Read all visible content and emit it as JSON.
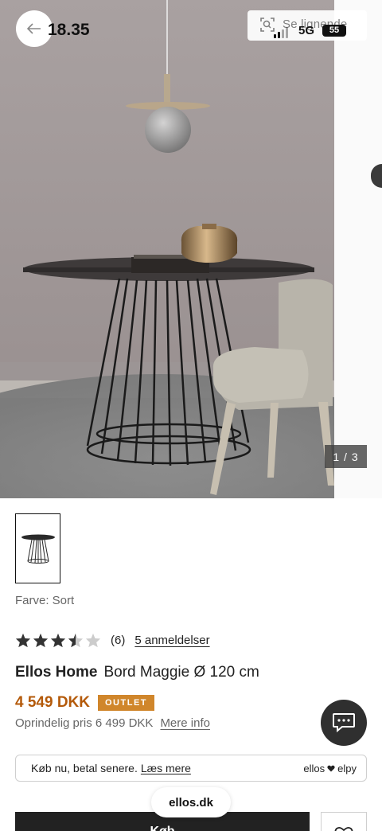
{
  "status_bar": {
    "time": "18.35",
    "network": "5G",
    "battery": "55"
  },
  "header": {
    "similar_label": "Se lignende",
    "back_icon": "arrow-left-icon",
    "similar_icon": "visual-search-icon"
  },
  "gallery": {
    "counter": "1 / 3"
  },
  "product": {
    "color_label": "Farve: Sort",
    "rating": {
      "stars": 3.5,
      "max": 5,
      "count": "(6)",
      "reviews_link": "5 anmeldelser"
    },
    "brand": "Ellos Home",
    "name": "Bord Maggie Ø 120 cm",
    "price": "4 549 DKK",
    "badge": "OUTLET",
    "original_price": "Oprindelig pris 6 499 DKK",
    "more_info": "Mere info",
    "accent_color": "#b45a0a",
    "badge_color": "#d0862b"
  },
  "bnpl": {
    "text": "Køb nu, betal senere.",
    "link": "Læs mere",
    "logo_left": "ellos",
    "logo_right": "elpy"
  },
  "actions": {
    "buy_label": "Køb",
    "wishlist_icon": "heart-icon",
    "chat_icon": "chat-bubble-icon"
  },
  "browser": {
    "url": "ellos.dk"
  }
}
